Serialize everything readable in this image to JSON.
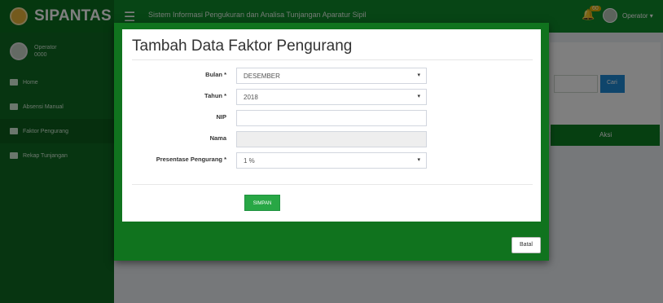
{
  "app": {
    "logo_text": "SIPANTAS",
    "hamburger": "☰",
    "header_title": "Sistem Informasi Pengukuran dan Analisa Tunjangan Aparatur Sipil",
    "notification_count": "60",
    "user_menu": "Operator ▾"
  },
  "sidebar": {
    "user_name": "Operator",
    "user_id": "0000",
    "items": [
      {
        "label": "Home"
      },
      {
        "label": "Absensi Manual"
      },
      {
        "label": "Faktor Pengurang"
      },
      {
        "label": "Rekap Tunjangan"
      }
    ]
  },
  "background": {
    "search_button": "Cari",
    "table_action_header": "Aksi",
    "collapse_label": "∧ ∨"
  },
  "modal": {
    "title": "Tambah Data Faktor Pengurang",
    "fields": {
      "bulan": {
        "label": "Bulan *",
        "value": "DESEMBER"
      },
      "tahun": {
        "label": "Tahun *",
        "value": "2018"
      },
      "nip": {
        "label": "NIP",
        "value": ""
      },
      "nama": {
        "label": "Nama",
        "value": ""
      },
      "presentase": {
        "label": "Presentase Pengurang *",
        "value": "1 %"
      }
    },
    "caret": "▾",
    "save_label": "SIMPAN",
    "cancel_label": "Batal"
  },
  "colors": {
    "primary_green": "#10731e",
    "header_green": "#0f8a2a",
    "save_green": "#28a745"
  }
}
